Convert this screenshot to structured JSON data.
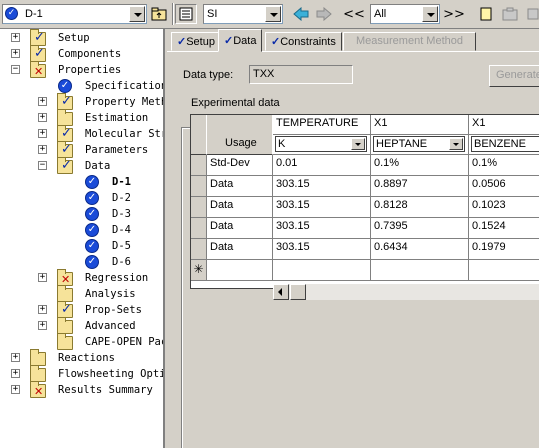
{
  "toolbar": {
    "item_combo": "D-1",
    "units_combo": "SI",
    "nav_prev": "<<",
    "filter_combo": "All",
    "nav_next": ">>"
  },
  "tree": {
    "items": [
      {
        "label": "Setup"
      },
      {
        "label": "Components"
      },
      {
        "label": "Properties"
      },
      {
        "label": "Specifications"
      },
      {
        "label": "Property Methods"
      },
      {
        "label": "Estimation"
      },
      {
        "label": "Molecular Structure"
      },
      {
        "label": "Parameters"
      },
      {
        "label": "Data"
      },
      {
        "label": "D-1"
      },
      {
        "label": "D-2"
      },
      {
        "label": "D-3"
      },
      {
        "label": "D-4"
      },
      {
        "label": "D-5"
      },
      {
        "label": "D-6"
      },
      {
        "label": "Regression"
      },
      {
        "label": "Analysis"
      },
      {
        "label": "Prop-Sets"
      },
      {
        "label": "Advanced"
      },
      {
        "label": "CAPE-OPEN Packages"
      },
      {
        "label": "Reactions"
      },
      {
        "label": "Flowsheeting Options"
      },
      {
        "label": "Results Summary"
      }
    ]
  },
  "tabs": [
    {
      "label": "Setup",
      "checked": true
    },
    {
      "label": "Data",
      "checked": true
    },
    {
      "label": "Constraints",
      "checked": true
    },
    {
      "label": "Measurement Method",
      "checked": false
    }
  ],
  "form": {
    "data_type_label": "Data type:",
    "data_type_value": "TXX",
    "generate_button": "Generate",
    "group_title": "Experimental data"
  },
  "grid": {
    "row_header_label": "Usage",
    "columns": [
      {
        "header": "TEMPERATURE",
        "unit": "K"
      },
      {
        "header": "X1",
        "unit": "HEPTANE"
      },
      {
        "header": "X1",
        "unit": "BENZENE"
      }
    ],
    "rows": [
      {
        "usage": "Std-Dev",
        "cells": [
          "0.01",
          "0.1%",
          "0.1%"
        ]
      },
      {
        "usage": "Data",
        "cells": [
          "303.15",
          "0.8897",
          "0.0506"
        ]
      },
      {
        "usage": "Data",
        "cells": [
          "303.15",
          "0.8128",
          "0.1023"
        ]
      },
      {
        "usage": "Data",
        "cells": [
          "303.15",
          "0.7395",
          "0.1524"
        ]
      },
      {
        "usage": "Data",
        "cells": [
          "303.15",
          "0.6434",
          "0.1979"
        ]
      }
    ],
    "new_row_marker": "✳"
  },
  "colors": {
    "check_blue": "#0a2aa8",
    "error_red": "#c00000",
    "folder_yellow": "#f6e39a",
    "window_gray": "#d4d0c8"
  }
}
